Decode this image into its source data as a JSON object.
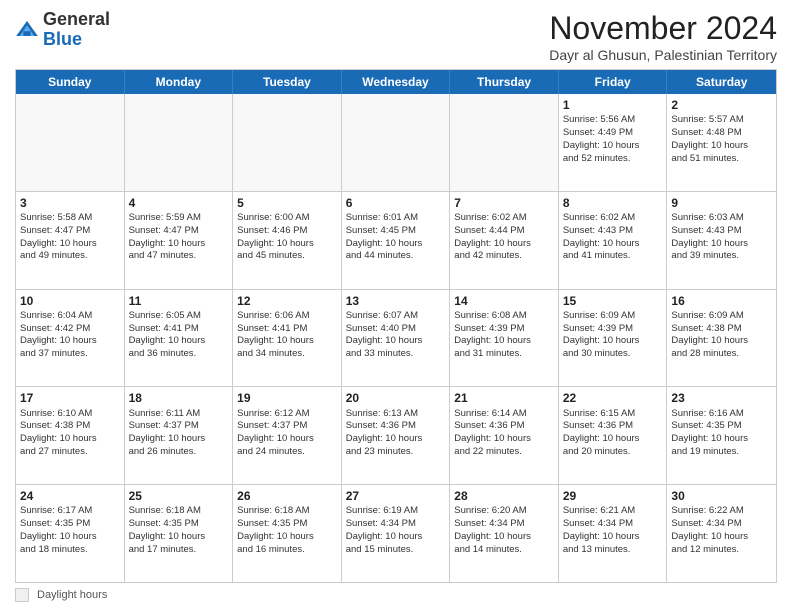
{
  "header": {
    "logo_general": "General",
    "logo_blue": "Blue",
    "month_title": "November 2024",
    "subtitle": "Dayr al Ghusun, Palestinian Territory"
  },
  "days_of_week": [
    "Sunday",
    "Monday",
    "Tuesday",
    "Wednesday",
    "Thursday",
    "Friday",
    "Saturday"
  ],
  "footer": {
    "label": "Daylight hours"
  },
  "weeks": [
    {
      "cells": [
        {
          "day": "",
          "content": "",
          "empty": true
        },
        {
          "day": "",
          "content": "",
          "empty": true
        },
        {
          "day": "",
          "content": "",
          "empty": true
        },
        {
          "day": "",
          "content": "",
          "empty": true
        },
        {
          "day": "",
          "content": "",
          "empty": true
        },
        {
          "day": "1",
          "content": "Sunrise: 5:56 AM\nSunset: 4:49 PM\nDaylight: 10 hours\nand 52 minutes.",
          "empty": false
        },
        {
          "day": "2",
          "content": "Sunrise: 5:57 AM\nSunset: 4:48 PM\nDaylight: 10 hours\nand 51 minutes.",
          "empty": false
        }
      ]
    },
    {
      "cells": [
        {
          "day": "3",
          "content": "Sunrise: 5:58 AM\nSunset: 4:47 PM\nDaylight: 10 hours\nand 49 minutes.",
          "empty": false
        },
        {
          "day": "4",
          "content": "Sunrise: 5:59 AM\nSunset: 4:47 PM\nDaylight: 10 hours\nand 47 minutes.",
          "empty": false
        },
        {
          "day": "5",
          "content": "Sunrise: 6:00 AM\nSunset: 4:46 PM\nDaylight: 10 hours\nand 45 minutes.",
          "empty": false
        },
        {
          "day": "6",
          "content": "Sunrise: 6:01 AM\nSunset: 4:45 PM\nDaylight: 10 hours\nand 44 minutes.",
          "empty": false
        },
        {
          "day": "7",
          "content": "Sunrise: 6:02 AM\nSunset: 4:44 PM\nDaylight: 10 hours\nand 42 minutes.",
          "empty": false
        },
        {
          "day": "8",
          "content": "Sunrise: 6:02 AM\nSunset: 4:43 PM\nDaylight: 10 hours\nand 41 minutes.",
          "empty": false
        },
        {
          "day": "9",
          "content": "Sunrise: 6:03 AM\nSunset: 4:43 PM\nDaylight: 10 hours\nand 39 minutes.",
          "empty": false
        }
      ]
    },
    {
      "cells": [
        {
          "day": "10",
          "content": "Sunrise: 6:04 AM\nSunset: 4:42 PM\nDaylight: 10 hours\nand 37 minutes.",
          "empty": false
        },
        {
          "day": "11",
          "content": "Sunrise: 6:05 AM\nSunset: 4:41 PM\nDaylight: 10 hours\nand 36 minutes.",
          "empty": false
        },
        {
          "day": "12",
          "content": "Sunrise: 6:06 AM\nSunset: 4:41 PM\nDaylight: 10 hours\nand 34 minutes.",
          "empty": false
        },
        {
          "day": "13",
          "content": "Sunrise: 6:07 AM\nSunset: 4:40 PM\nDaylight: 10 hours\nand 33 minutes.",
          "empty": false
        },
        {
          "day": "14",
          "content": "Sunrise: 6:08 AM\nSunset: 4:39 PM\nDaylight: 10 hours\nand 31 minutes.",
          "empty": false
        },
        {
          "day": "15",
          "content": "Sunrise: 6:09 AM\nSunset: 4:39 PM\nDaylight: 10 hours\nand 30 minutes.",
          "empty": false
        },
        {
          "day": "16",
          "content": "Sunrise: 6:09 AM\nSunset: 4:38 PM\nDaylight: 10 hours\nand 28 minutes.",
          "empty": false
        }
      ]
    },
    {
      "cells": [
        {
          "day": "17",
          "content": "Sunrise: 6:10 AM\nSunset: 4:38 PM\nDaylight: 10 hours\nand 27 minutes.",
          "empty": false
        },
        {
          "day": "18",
          "content": "Sunrise: 6:11 AM\nSunset: 4:37 PM\nDaylight: 10 hours\nand 26 minutes.",
          "empty": false
        },
        {
          "day": "19",
          "content": "Sunrise: 6:12 AM\nSunset: 4:37 PM\nDaylight: 10 hours\nand 24 minutes.",
          "empty": false
        },
        {
          "day": "20",
          "content": "Sunrise: 6:13 AM\nSunset: 4:36 PM\nDaylight: 10 hours\nand 23 minutes.",
          "empty": false
        },
        {
          "day": "21",
          "content": "Sunrise: 6:14 AM\nSunset: 4:36 PM\nDaylight: 10 hours\nand 22 minutes.",
          "empty": false
        },
        {
          "day": "22",
          "content": "Sunrise: 6:15 AM\nSunset: 4:36 PM\nDaylight: 10 hours\nand 20 minutes.",
          "empty": false
        },
        {
          "day": "23",
          "content": "Sunrise: 6:16 AM\nSunset: 4:35 PM\nDaylight: 10 hours\nand 19 minutes.",
          "empty": false
        }
      ]
    },
    {
      "cells": [
        {
          "day": "24",
          "content": "Sunrise: 6:17 AM\nSunset: 4:35 PM\nDaylight: 10 hours\nand 18 minutes.",
          "empty": false
        },
        {
          "day": "25",
          "content": "Sunrise: 6:18 AM\nSunset: 4:35 PM\nDaylight: 10 hours\nand 17 minutes.",
          "empty": false
        },
        {
          "day": "26",
          "content": "Sunrise: 6:18 AM\nSunset: 4:35 PM\nDaylight: 10 hours\nand 16 minutes.",
          "empty": false
        },
        {
          "day": "27",
          "content": "Sunrise: 6:19 AM\nSunset: 4:34 PM\nDaylight: 10 hours\nand 15 minutes.",
          "empty": false
        },
        {
          "day": "28",
          "content": "Sunrise: 6:20 AM\nSunset: 4:34 PM\nDaylight: 10 hours\nand 14 minutes.",
          "empty": false
        },
        {
          "day": "29",
          "content": "Sunrise: 6:21 AM\nSunset: 4:34 PM\nDaylight: 10 hours\nand 13 minutes.",
          "empty": false
        },
        {
          "day": "30",
          "content": "Sunrise: 6:22 AM\nSunset: 4:34 PM\nDaylight: 10 hours\nand 12 minutes.",
          "empty": false
        }
      ]
    }
  ]
}
